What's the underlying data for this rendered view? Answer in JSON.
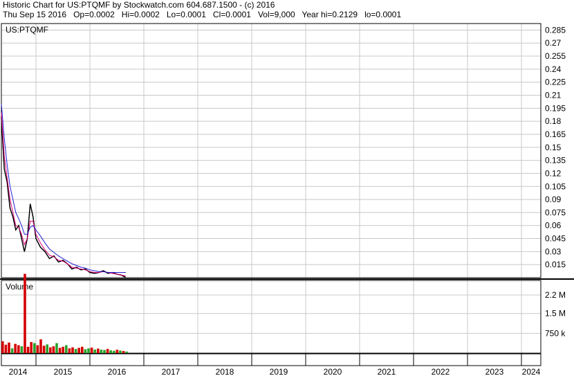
{
  "header": {
    "line1": "Historic Chart for US:PTQMF by Stockwatch.com 604.687.1500 - (c) 2016",
    "line2": "Thu Sep 15 2016   Op=0.0002   Hi=0.0002   Lo=0.0001   Cl=0.0001   Vol=9,000   Year hi=0.2129   lo=0.0001"
  },
  "colors": {
    "grid": "#c8c8c8",
    "price": "#000000",
    "ma_short": "#e0007a",
    "ma_long": "#1f1fd0",
    "vol_down": "#d40000",
    "vol_up": "#2aa02a"
  },
  "chart_data": [
    {
      "type": "line",
      "symbol_label": "US:PTQMF",
      "x": [
        "2014-01",
        "2014-02",
        "2014-03",
        "2014-04",
        "2014-05",
        "2014-06",
        "2014-07",
        "2014-08",
        "2014-09",
        "2014-10",
        "2014-11",
        "2014-12",
        "2015-01",
        "2015-02",
        "2015-03",
        "2015-04",
        "2015-05",
        "2015-06",
        "2015-07",
        "2015-08",
        "2015-09",
        "2015-10",
        "2015-11",
        "2015-12",
        "2016-01",
        "2016-02",
        "2016-03",
        "2016-04",
        "2016-05",
        "2016-06",
        "2016-07",
        "2016-08",
        "2016-09"
      ],
      "series": [
        {
          "key": "close",
          "values": [
            0.185,
            0.125,
            0.11,
            0.08,
            0.07,
            0.055,
            0.06,
            0.045,
            0.03,
            0.045,
            0.085,
            0.07,
            0.045,
            0.035,
            0.03,
            0.022,
            0.025,
            0.018,
            0.02,
            0.016,
            0.01,
            0.012,
            0.009,
            0.01,
            0.006,
            0.005,
            0.006,
            0.008,
            0.005,
            0.006,
            0.004,
            0.003,
            0.0001
          ]
        },
        {
          "key": "ma_short",
          "values": [
            0.19,
            0.14,
            0.115,
            0.09,
            0.075,
            0.06,
            0.058,
            0.05,
            0.038,
            0.045,
            0.065,
            0.065,
            0.05,
            0.04,
            0.032,
            0.026,
            0.024,
            0.02,
            0.019,
            0.016,
            0.012,
            0.011,
            0.01,
            0.009,
            0.007,
            0.006,
            0.006,
            0.007,
            0.006,
            0.005,
            0.004,
            0.003,
            0.002
          ]
        },
        {
          "key": "ma_long",
          "values": [
            0.2,
            0.16,
            0.13,
            0.105,
            0.09,
            0.075,
            0.068,
            0.06,
            0.05,
            0.05,
            0.058,
            0.06,
            0.055,
            0.048,
            0.04,
            0.033,
            0.029,
            0.025,
            0.022,
            0.019,
            0.016,
            0.014,
            0.012,
            0.011,
            0.009,
            0.008,
            0.007,
            0.007,
            0.006,
            0.006,
            0.006,
            0.006,
            0.006
          ]
        }
      ],
      "y_ticks": [
        "0.285",
        "0.27",
        "0.255",
        "0.24",
        "0.225",
        "0.21",
        "0.195",
        "0.18",
        "0.165",
        "0.15",
        "0.135",
        "0.12",
        "0.105",
        "0.09",
        "0.075",
        "0.06",
        "0.045",
        "0.03",
        "0.015"
      ],
      "ylim": [
        0,
        0.2925
      ],
      "grid": true
    },
    {
      "type": "bar",
      "title": "Volume",
      "y_ticks": [
        "2.2 M",
        "1.5 M",
        "750 k"
      ],
      "ylim": [
        0,
        2750000
      ],
      "values": [
        450000,
        320000,
        400000,
        180000,
        350000,
        300000,
        260000,
        3000000,
        240000,
        420000,
        380000,
        300000,
        520000,
        280000,
        330000,
        220000,
        260000,
        380000,
        200000,
        240000,
        300000,
        180000,
        220000,
        160000,
        200000,
        240000,
        150000,
        180000,
        210000,
        140000,
        170000,
        130000,
        120000,
        160000,
        110000,
        90000,
        130000,
        100000,
        80000,
        60000
      ],
      "up": [
        false,
        false,
        false,
        true,
        false,
        false,
        true,
        false,
        false,
        false,
        true,
        false,
        false,
        false,
        true,
        false,
        false,
        true,
        false,
        false,
        true,
        false,
        false,
        true,
        false,
        false,
        true,
        true,
        false,
        true,
        false,
        true,
        true,
        false,
        true,
        true,
        false,
        true,
        false,
        true
      ],
      "x_ticks": [
        "2014",
        "2015",
        "2016",
        "2017",
        "2018",
        "2019",
        "2020",
        "2021",
        "2022",
        "2023",
        "2024"
      ],
      "grid": true
    }
  ]
}
